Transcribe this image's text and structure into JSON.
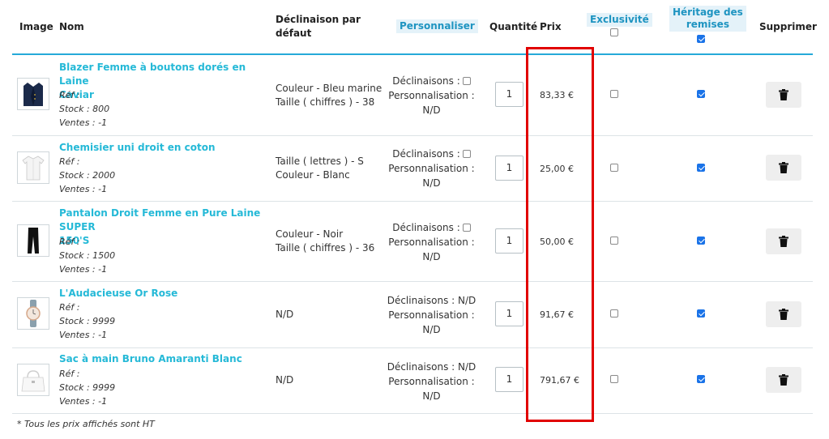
{
  "header": {
    "image": "Image",
    "nom": "Nom",
    "declinaison_line1": "Déclinaison par",
    "declinaison_line2": "défaut",
    "personnaliser": "Personnaliser",
    "quantite": "Quantité",
    "prix": "Prix",
    "exclusivite": "Exclusivité",
    "exclusivite_checked": false,
    "heritage_line1": "Héritage des",
    "heritage_line2": "remises",
    "heritage_checked": true,
    "supprimer": "Supprimer"
  },
  "rows": [
    {
      "name_line1": "Blazer Femme à boutons dorés en Laine",
      "name_line2": "Caviar",
      "ref": "Réf :",
      "stock": "Stock : 800",
      "ventes": "Ventes : -1",
      "decl_line1": "Couleur - Bleu marine",
      "decl_line2": "Taille ( chiffres ) - 38",
      "perso_decl": "Déclinaisons :",
      "perso_decl_value": "",
      "perso_label": "Personnalisation :",
      "perso_value": "N/D",
      "quantity": "1",
      "price": "83,33 €",
      "exclusivite": false,
      "heritage": true,
      "image_icon": "blazer-image"
    },
    {
      "name_line1": "Chemisier uni droit en coton",
      "name_line2": "",
      "ref": "Réf :",
      "stock": "Stock : 2000",
      "ventes": "Ventes : -1",
      "decl_line1": "Taille ( lettres ) - S",
      "decl_line2": "Couleur - Blanc",
      "perso_decl": "Déclinaisons :",
      "perso_decl_value": "",
      "perso_label": "Personnalisation :",
      "perso_value": "N/D",
      "quantity": "1",
      "price": "25,00 €",
      "exclusivite": false,
      "heritage": true,
      "image_icon": "shirt-image"
    },
    {
      "name_line1": "Pantalon Droit Femme en Pure Laine SUPER",
      "name_line2": "150'S",
      "ref": "Réf :",
      "stock": "Stock : 1500",
      "ventes": "Ventes : -1",
      "decl_line1": "Couleur - Noir",
      "decl_line2": "Taille ( chiffres ) - 36",
      "perso_decl": "Déclinaisons :",
      "perso_decl_value": "",
      "perso_label": "Personnalisation :",
      "perso_value": "N/D",
      "quantity": "1",
      "price": "50,00 €",
      "exclusivite": false,
      "heritage": true,
      "image_icon": "pants-image"
    },
    {
      "name_line1": "L'Audacieuse Or Rose",
      "name_line2": "",
      "ref": "Réf :",
      "stock": "Stock : 9999",
      "ventes": "Ventes : -1",
      "decl_line1": "N/D",
      "decl_line2": "",
      "perso_decl": "Déclinaisons :",
      "perso_decl_value": "N/D",
      "perso_label": "Personnalisation :",
      "perso_value": "N/D",
      "quantity": "1",
      "price": "91,67 €",
      "exclusivite": false,
      "heritage": true,
      "image_icon": "watch-image"
    },
    {
      "name_line1": "Sac à main Bruno Amaranti Blanc",
      "name_line2": "",
      "ref": "Réf :",
      "stock": "Stock : 9999",
      "ventes": "Ventes : -1",
      "decl_line1": "N/D",
      "decl_line2": "",
      "perso_decl": "Déclinaisons :",
      "perso_decl_value": "N/D",
      "perso_label": "Personnalisation :",
      "perso_value": "N/D",
      "quantity": "1",
      "price": "791,67 €",
      "exclusivite": false,
      "heritage": true,
      "image_icon": "handbag-image"
    }
  ],
  "footnote": "* Tous les prix affichés sont HT",
  "colors": {
    "link": "#25b9d7",
    "accent_line": "#25a9d8",
    "highlight_box": "#e10000",
    "checkbox_checked": "#1a73e8"
  }
}
